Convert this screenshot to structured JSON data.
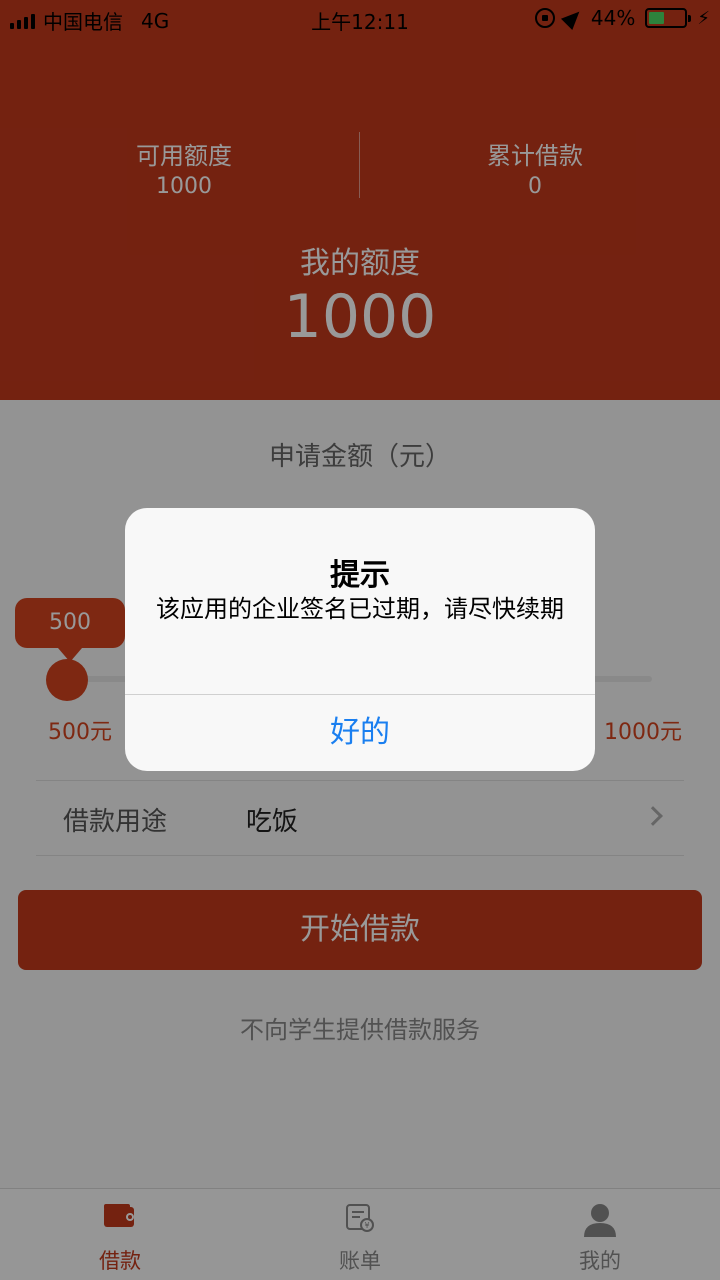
{
  "status_bar": {
    "carrier": "中国电信",
    "network": "4G",
    "time": "上午12:11",
    "battery_percent": "44%",
    "battery_level": 0.44,
    "battery_color": "#4cd964"
  },
  "header": {
    "available_label": "可用额度",
    "available_value": "1000",
    "total_borrowed_label": "累计借款",
    "total_borrowed_value": "0",
    "quota_title": "我的额度",
    "quota_value": "1000"
  },
  "apply": {
    "label": "申请金额（元）",
    "slider_value": "500",
    "slider_fraction": 0.0,
    "min_label": "500元",
    "max_label": "1000元"
  },
  "purpose": {
    "label": "借款用途",
    "value": "吃饭"
  },
  "borrow_button_label": "开始借款",
  "notice_text": "不向学生提供借款服务",
  "tabs": [
    {
      "label": "借款",
      "icon": "wallet-icon",
      "active": true
    },
    {
      "label": "账单",
      "icon": "bill-icon",
      "active": false
    },
    {
      "label": "我的",
      "icon": "user-icon",
      "active": false
    }
  ],
  "alert": {
    "title": "提示",
    "message": "该应用的企业签名已过期，请尽快续期",
    "ok_label": "好的"
  },
  "colors": {
    "brand": "#c2391c",
    "accent": "#d2431f",
    "link": "#1a7ff0"
  }
}
